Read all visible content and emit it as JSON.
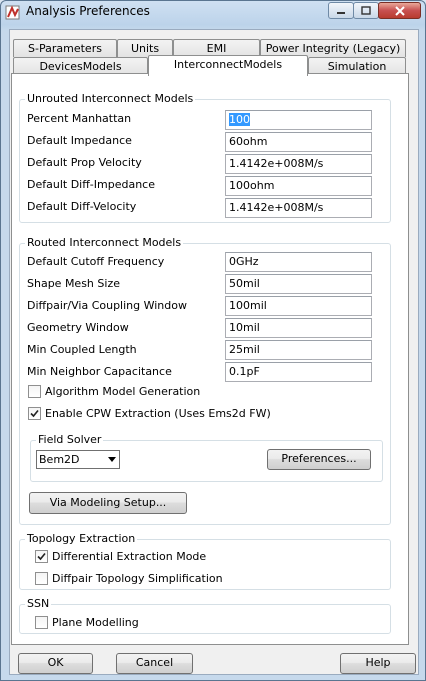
{
  "window": {
    "title": "Analysis Preferences"
  },
  "tabs_row1": [
    "S-Parameters",
    "Units",
    "EMI",
    "Power Integrity (Legacy)"
  ],
  "tabs_row2": [
    "DevicesModels",
    "InterconnectModels",
    "Simulation"
  ],
  "active_tab": "InterconnectModels",
  "unrouted": {
    "legend": "Unrouted Interconnect Models",
    "fields": [
      {
        "label": "Percent Manhattan",
        "value": "100"
      },
      {
        "label": "Default Impedance",
        "value": "60ohm"
      },
      {
        "label": "Default Prop Velocity",
        "value": "1.4142e+008M/s"
      },
      {
        "label": "Default Diff-Impedance",
        "value": "100ohm"
      },
      {
        "label": "Default Diff-Velocity",
        "value": "1.4142e+008M/s"
      }
    ]
  },
  "routed": {
    "legend": "Routed Interconnect Models",
    "fields": [
      {
        "label": "Default Cutoff Frequency",
        "value": "0GHz"
      },
      {
        "label": "Shape Mesh Size",
        "value": "50mil"
      },
      {
        "label": "Diffpair/Via Coupling Window",
        "value": "100mil"
      },
      {
        "label": "Geometry Window",
        "value": "10mil"
      },
      {
        "label": "Min Coupled Length",
        "value": "25mil"
      },
      {
        "label": "Min Neighbor Capacitance",
        "value": "0.1pF"
      }
    ],
    "checkboxes": [
      {
        "label": "Algorithm Model Generation",
        "checked": false
      },
      {
        "label": "Enable CPW Extraction (Uses Ems2d FW)",
        "checked": true
      }
    ],
    "field_solver": {
      "legend": "Field Solver",
      "selected": "Bem2D",
      "preferences_label": "Preferences..."
    },
    "via_button_label": "Via Modeling Setup..."
  },
  "topology": {
    "legend": "Topology Extraction",
    "checkboxes": [
      {
        "label": "Differential Extraction Mode",
        "checked": true
      },
      {
        "label": "Diffpair Topology Simplification",
        "checked": false
      }
    ]
  },
  "ssn": {
    "legend": "SSN",
    "checkboxes": [
      {
        "label": "Plane Modelling",
        "checked": false
      }
    ]
  },
  "buttons": {
    "ok": "OK",
    "cancel": "Cancel",
    "help": "Help"
  }
}
